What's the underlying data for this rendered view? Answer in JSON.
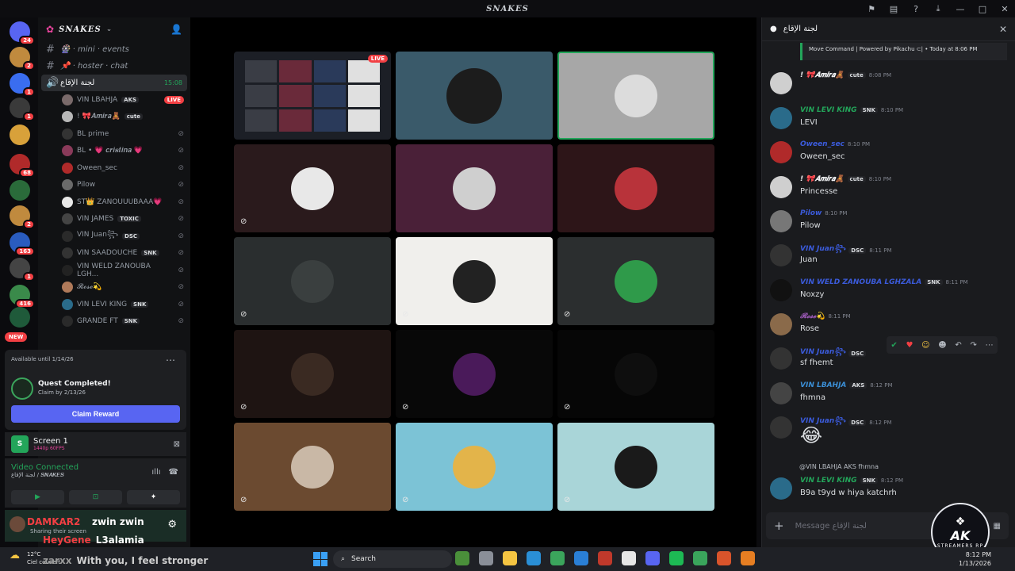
{
  "window": {
    "title": "𝑺𝑵𝑨𝑲𝑬𝑺"
  },
  "servers": [
    {
      "badge": "24",
      "color": "#5865f2"
    },
    {
      "badge": "2",
      "color": "#c08a3e"
    },
    {
      "badge": "1",
      "color": "#3a6df0"
    },
    {
      "badge": "1",
      "color": "#3a3a3a"
    },
    {
      "badge": "",
      "color": "#d8a13a"
    },
    {
      "badge": "68",
      "color": "#b02a2a"
    },
    {
      "badge": "",
      "color": "#2a6b3a"
    },
    {
      "badge": "2",
      "color": "#c08a3e"
    },
    {
      "badge": "163",
      "color": "#2a5cbf"
    },
    {
      "badge": "1",
      "color": "#444"
    },
    {
      "badge": "416",
      "color": "#3a8a4a"
    },
    {
      "badge": "",
      "color": "#1f5a3a"
    }
  ],
  "server_new_label": "NEW",
  "guild": {
    "name": "𝑺𝑵𝑨𝑲𝑬𝑺"
  },
  "channels": [
    {
      "prefix": "#",
      "label": "🎡 · mini · events",
      "active": false
    },
    {
      "prefix": "#",
      "label": "📌 · hoster · chat",
      "active": false
    },
    {
      "prefix": "🔊",
      "label": "لجنة الإقاع",
      "active": true,
      "time": "15:08"
    }
  ],
  "voice_users": [
    {
      "name": "VIN LBAHJA",
      "tag": "AKS",
      "live": "LIVE"
    },
    {
      "name": "! 🎀𝑨𝒎𝒊𝒓𝒂🧸",
      "tag": "cute"
    },
    {
      "name": "BL prime"
    },
    {
      "name": "BL • 💗 𝒄𝒓𝒊𝒔𝒕𝒊𝒏𝒂 💗"
    },
    {
      "name": "Oween_sec"
    },
    {
      "name": "Pilow"
    },
    {
      "name": "ST👑 ZANOUUUBAAA💗"
    },
    {
      "name": "VIN JAMES",
      "tag": "TOXIC"
    },
    {
      "name": "VIN Juan꧂",
      "tag": "DSC"
    },
    {
      "name": "VIN SAADOUCHE",
      "tag": "SNK"
    },
    {
      "name": "VIN WELD ZANOUBA LGH..."
    },
    {
      "name": "𝓡𝓸𝓼𝓮💫"
    },
    {
      "name": "VIN LEVI KING",
      "tag": "SNK"
    },
    {
      "name": "GRANDE FT",
      "tag": "SNK"
    }
  ],
  "quest": {
    "available": "Available until 1/14/26",
    "title": "Quest Completed!",
    "subtitle": "Claim by 2/13/26",
    "button": "Claim Reward"
  },
  "screen_share": {
    "name": "Screen 1",
    "quality": "1440p 60FPS"
  },
  "voice_status": {
    "title": "Video Connected",
    "subtitle": "لجنة الإقاع / 𝑺𝑵𝑨𝑲𝑬𝑺"
  },
  "user_panel": {
    "name": "DAMKAR2",
    "status": "Sharing their screen",
    "overlay_user": "zwin zwin",
    "overlay_line2_name": "HeyGene",
    "overlay_line2_text": "L3alamia",
    "overlay_line3_name": "zarxx",
    "overlay_line3_text": "With you, I feel stronger"
  },
  "stage_tiles": [
    {
      "kind": "screen",
      "bg": "#1c1f26",
      "live": "LIVE"
    },
    {
      "kind": "camera",
      "bg": "#3a5a6a"
    },
    {
      "kind": "avatar",
      "bg": "#a7a7a7",
      "avatar": "#dcdcdc",
      "border": "#23a55a"
    },
    {
      "kind": "avatar",
      "bg": "#2a1a1c",
      "avatar": "#e8e8e8"
    },
    {
      "kind": "avatar",
      "bg": "#4a2038",
      "avatar": "#cfcfcf"
    },
    {
      "kind": "avatar",
      "bg": "#2d1518",
      "avatar": "#b8333a"
    },
    {
      "kind": "avatar",
      "bg": "#2a2e2f",
      "avatar": "#3a3f3f"
    },
    {
      "kind": "avatar",
      "bg": "#f0efec",
      "avatar": "#222"
    },
    {
      "kind": "avatar",
      "bg": "#2b2e2f",
      "avatar": "#2f9a4a"
    },
    {
      "kind": "avatar",
      "bg": "#1e1412",
      "avatar": "#3a2a22"
    },
    {
      "kind": "avatar",
      "bg": "#080808",
      "avatar": "#4a1a5a"
    },
    {
      "kind": "avatar",
      "bg": "#060606",
      "avatar": "#0e0e0e"
    },
    {
      "kind": "avatar",
      "bg": "#6b4a30",
      "avatar": "#c9b8a6"
    },
    {
      "kind": "avatar",
      "bg": "#7cc3d6",
      "avatar": "#e3b44a"
    },
    {
      "kind": "avatar",
      "bg": "#a9d5d8",
      "avatar": "#1a1a1a"
    }
  ],
  "chat": {
    "title": "لجنة الإقاع",
    "embed": "Move Command | Powered by Pikachu ⊂| • Today at 8:06 PM",
    "messages": [
      {
        "name": "! 🎀𝑨𝒎𝒊𝒓𝒂🧸",
        "tag": "cute",
        "time": "8:08 PM",
        "text": "",
        "color": "#f2f3f5"
      },
      {
        "name": "VIN LEVI KING",
        "tag": "SNK",
        "time": "8:10 PM",
        "text": "LEVI",
        "color": "#23a55a"
      },
      {
        "name": "Oween_sec",
        "tag": "",
        "time": "8:10 PM",
        "text": "Oween_sec",
        "color": "#3b5bdb"
      },
      {
        "name": "! 🎀𝑨𝒎𝒊𝒓𝒂🧸",
        "tag": "cute",
        "time": "8:10 PM",
        "text": "Princesse",
        "color": "#f2f3f5"
      },
      {
        "name": "Pilow",
        "tag": "",
        "time": "8:10 PM",
        "text": "Pilow",
        "color": "#3b5bdb"
      },
      {
        "name": "VIN Juan꧂",
        "tag": "DSC",
        "time": "8:11 PM",
        "text": "Juan",
        "color": "#3b5bdb"
      },
      {
        "name": "VIN WELD ZANOUBA LGHZALA",
        "tag": "SNK",
        "time": "8:11 PM",
        "text": "Noxzy",
        "color": "#3b5bdb"
      },
      {
        "name": "𝓡𝓸𝓼𝓮💫",
        "tag": "",
        "time": "8:11 PM",
        "text": "Rose",
        "color": "#9b59b6"
      },
      {
        "name": "VIN Juan꧂",
        "tag": "DSC",
        "time": "",
        "text": "sf fhemt",
        "color": "#3b5bdb"
      },
      {
        "name": "VIN LBAHJA",
        "tag": "AKS",
        "time": "8:12 PM",
        "text": "fhmna",
        "color": "#3b8fd6"
      },
      {
        "name": "VIN Juan꧂",
        "tag": "DSC",
        "time": "8:12 PM",
        "text": "😂",
        "color": "#3b5bdb"
      },
      {
        "name": "VIN LEVI KING",
        "tag": "SNK",
        "time": "8:12 PM",
        "text": "B9a t9yd w hiya katchrh",
        "color": "#23a55a"
      }
    ],
    "reply": "@VIN LBAHJA  AKS  fhmna",
    "input_placeholder": "Message لجنة الإقاع"
  },
  "ak_logo": {
    "title": "AK",
    "subtitle": "STREAMERS RP"
  },
  "taskbar": {
    "weather_temp": "12°C",
    "weather_desc": "Ciel couvert",
    "search": "Search",
    "time": "8:12 PM",
    "date": "1/13/2026",
    "apps": [
      "#4a8f3a",
      "#8a8f98",
      "#f5c542",
      "#2a8fd6",
      "#3ba55c",
      "#2a7fd6",
      "#c0392b",
      "#e6e6e6",
      "#5865f2",
      "#1db954",
      "#3aa55c",
      "#d9542b",
      "#e67e22"
    ]
  }
}
